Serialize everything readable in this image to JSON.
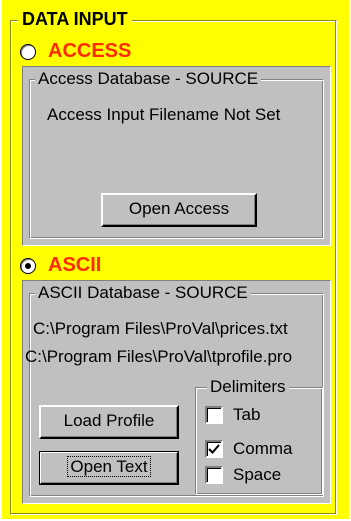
{
  "data_input": {
    "legend": "DATA INPUT"
  },
  "access": {
    "radio_label": "ACCESS",
    "selected": false,
    "source_legend": "Access Database - SOURCE",
    "status_text": "Access Input Filename Not Set",
    "open_button": "Open Access"
  },
  "ascii": {
    "radio_label": "ASCII",
    "selected": true,
    "source_legend": "ASCII Database - SOURCE",
    "file_path": "C:\\Program Files\\ProVal\\prices.txt",
    "profile_path": "C:\\Program Files\\ProVal\\tprofile.pro",
    "load_profile_button": "Load Profile",
    "open_text_button": "Open Text",
    "delimiters": {
      "legend": "Delimiters",
      "tab": {
        "label": "Tab",
        "checked": false
      },
      "comma": {
        "label": "Comma",
        "checked": true
      },
      "space": {
        "label": "Space",
        "checked": false
      }
    }
  },
  "colors": {
    "panel_bg": "#ffff00",
    "group_bg": "#c0c0c0",
    "radio_label": "#ff2a00"
  }
}
